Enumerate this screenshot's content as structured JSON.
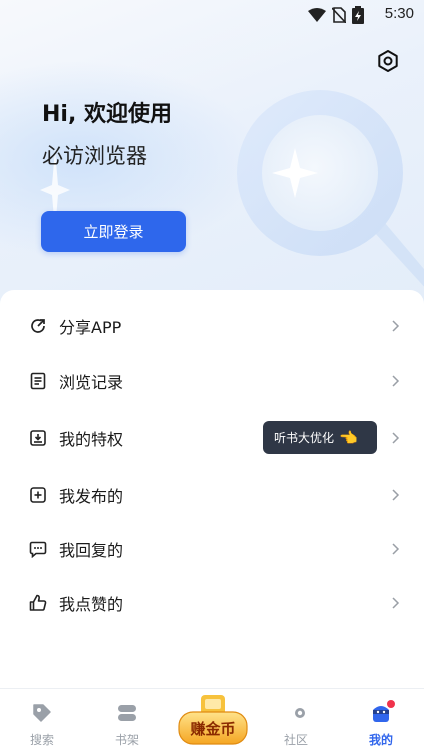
{
  "status_bar": {
    "time": "5:30",
    "icons": [
      "wifi-icon",
      "no-sim-icon",
      "battery-icon"
    ]
  },
  "header": {
    "settings_icon": "settings-icon",
    "greeting_line1": "Hi, 欢迎使用",
    "greeting_line2": "必访浏览器",
    "login_label": "立即登录"
  },
  "menu": {
    "items": [
      {
        "label": "分享APP",
        "icon": "share-icon"
      },
      {
        "label": "浏览记录",
        "icon": "history-icon"
      },
      {
        "label": "我的特权",
        "icon": "privilege-icon"
      },
      {
        "label": "我发布的",
        "icon": "post-icon"
      },
      {
        "label": "我回复的",
        "icon": "reply-icon"
      },
      {
        "label": "我点赞的",
        "icon": "like-icon"
      }
    ],
    "tooltip": "听书大优化"
  },
  "tabbar": {
    "tabs": [
      {
        "label": "搜索",
        "icon": "search-tab-icon"
      },
      {
        "label": "书架",
        "icon": "bookshelf-icon"
      },
      {
        "label": "赚金币",
        "icon": "coin-icon"
      },
      {
        "label": "社区",
        "icon": "community-icon"
      },
      {
        "label": "我的",
        "icon": "profile-icon"
      }
    ],
    "active_index": 4
  },
  "colors": {
    "accent": "#2e67ec",
    "tab_active": "#3166ec",
    "tab_inactive": "#9aa0a8",
    "badge": "#f0324b"
  }
}
